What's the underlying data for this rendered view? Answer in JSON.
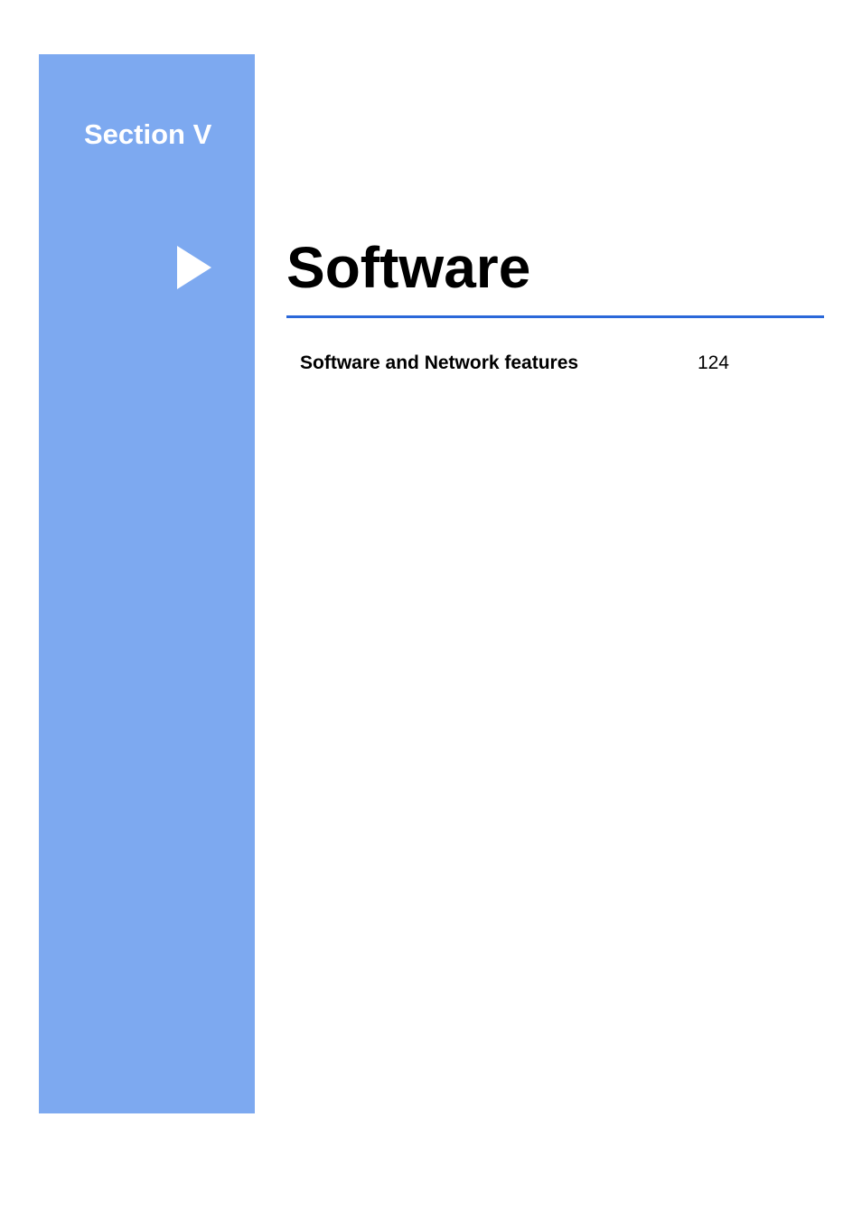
{
  "sidebar": {
    "section_label": "Section V"
  },
  "main": {
    "title": "Software"
  },
  "toc": {
    "items": [
      {
        "label": "Software and Network features",
        "page": "124"
      }
    ]
  }
}
